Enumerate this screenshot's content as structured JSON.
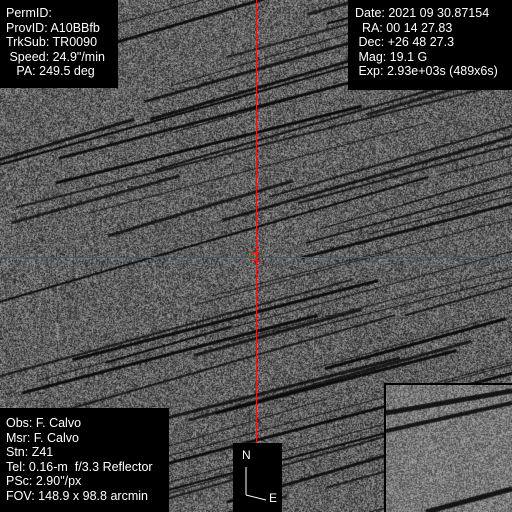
{
  "observation": {
    "left_panel": {
      "perm_id": "PermID:",
      "prov_id": "ProvID: A10BBfb",
      "trk_sub": "TrkSub: TR0090",
      "speed": " Speed: 24.9\"/min",
      "pa": "   PA: 249.5 deg"
    },
    "right_panel": {
      "date": "Date: 2021 09 30.87154",
      "ra": "  RA: 00 14 27.83",
      "dec": " Dec: +26 48 27.3",
      "mag": " Mag: 19.1 G",
      "exp": " Exp: 2.93e+03s (489x6s)"
    },
    "bottom_panel": {
      "obs": "Obs: F. Calvo",
      "msr": "Msr: F. Calvo",
      "stn": "Stn: Z41",
      "tel": "Tel: 0.16-m  f/3.3 Reflector",
      "psc": "PSc: 2.90\"/px",
      "fov": "FOV: 148.9 x 98.8 arcmin"
    }
  },
  "compass": {
    "north_label": "N",
    "east_label": "E"
  },
  "colors": {
    "crosshair": "#d42020",
    "panel_bg": "#000000",
    "panel_text": "#ffffff",
    "sky_background": "#7a7a7a"
  },
  "icons": {
    "compass": "compass-rose-icon",
    "target_box": "target-box-icon"
  }
}
